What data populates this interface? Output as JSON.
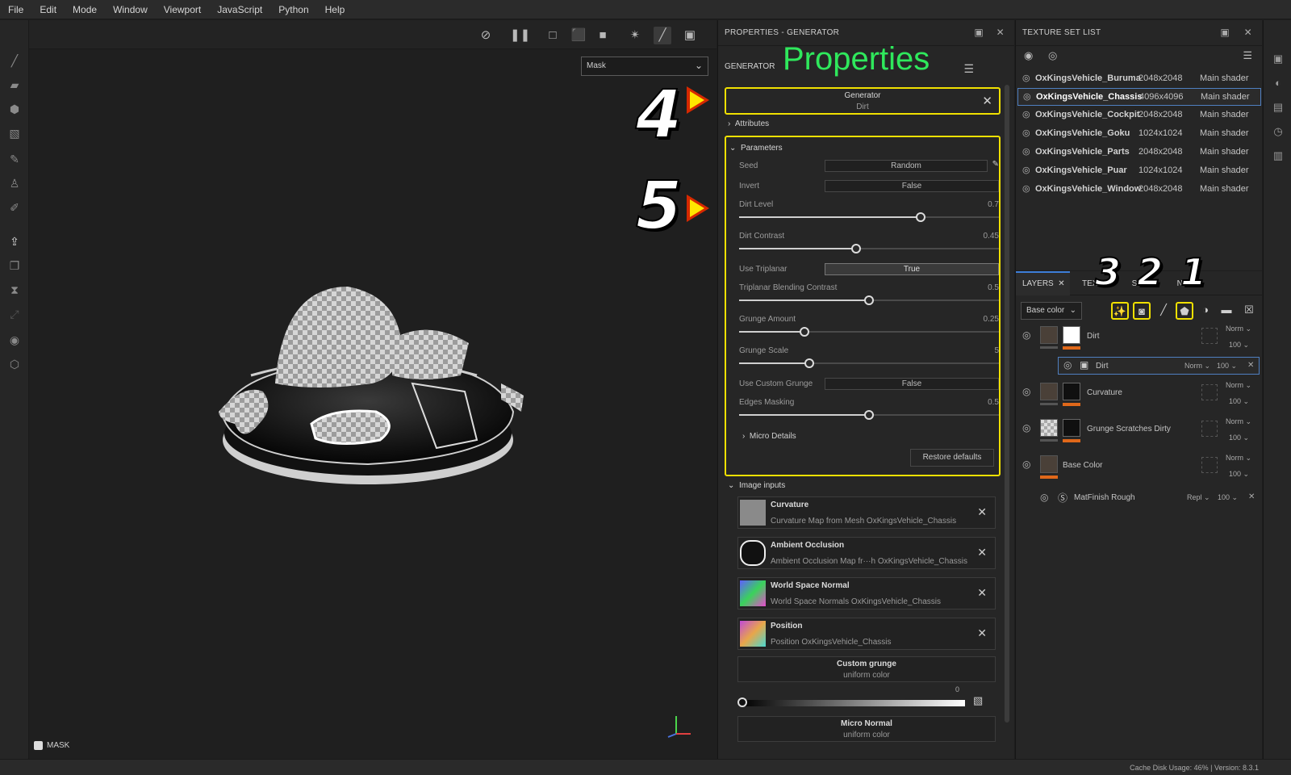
{
  "menu": [
    "File",
    "Edit",
    "Mode",
    "Window",
    "Viewport",
    "JavaScript",
    "Python",
    "Help"
  ],
  "viewport": {
    "channel_dropdown": "Mask",
    "mask_label": "MASK"
  },
  "annotations": {
    "n1": "1",
    "n2": "2",
    "n3": "3",
    "n4": "4",
    "n5": "5",
    "properties_word": "Properties"
  },
  "properties": {
    "title": "PROPERTIES - GENERATOR",
    "section": "GENERATOR",
    "generator_label": "Generator",
    "generator_value": "Dirt",
    "attributes": "Attributes",
    "parameters": "Parameters",
    "seed_label": "Seed",
    "seed_value": "Random",
    "invert_label": "Invert",
    "invert_value": "False",
    "dirt_level_label": "Dirt Level",
    "dirt_level_value": "0.7",
    "dirt_level": 0.7,
    "dirt_contrast_label": "Dirt Contrast",
    "dirt_contrast_value": "0.45",
    "dirt_contrast": 0.45,
    "use_triplanar_label": "Use Triplanar",
    "use_triplanar_value": "True",
    "triplanar_label": "Triplanar Blending Contrast",
    "triplanar_value": "0.5",
    "triplanar": 0.5,
    "grunge_amount_label": "Grunge Amount",
    "grunge_amount_value": "0.25",
    "grunge_amount": 0.25,
    "grunge_scale_label": "Grunge Scale",
    "grunge_scale_value": "5",
    "grunge_scale": 0.27,
    "use_custom_grunge_label": "Use Custom Grunge",
    "use_custom_grunge_value": "False",
    "edges_masking_label": "Edges Masking",
    "edges_masking_value": "0.5",
    "edges_masking": 0.5,
    "micro_details": "Micro Details",
    "restore_defaults": "Restore defaults",
    "image_inputs": "Image inputs",
    "inputs": [
      {
        "name": "Curvature",
        "desc": "Curvature Map from Mesh OxKingsVehicle_Chassis"
      },
      {
        "name": "Ambient Occlusion",
        "desc": "Ambient Occlusion Map fr···h OxKingsVehicle_Chassis"
      },
      {
        "name": "World Space Normal",
        "desc": "World Space Normals OxKingsVehicle_Chassis"
      },
      {
        "name": "Position",
        "desc": "Position OxKingsVehicle_Chassis"
      }
    ],
    "custom_grunge": "Custom grunge",
    "custom_grunge_sub": "uniform color",
    "grunge_slider_value": "0",
    "micro_normal": "Micro Normal",
    "micro_normal_sub": "uniform color"
  },
  "texture_set_list": {
    "title": "TEXTURE SET LIST",
    "rows": [
      {
        "name": "OxKingsVehicle_Buruma",
        "res": "2048x2048",
        "shader": "Main shader"
      },
      {
        "name": "OxKingsVehicle_Chassis",
        "res": "4096x4096",
        "shader": "Main shader"
      },
      {
        "name": "OxKingsVehicle_Cockpit",
        "res": "2048x2048",
        "shader": "Main shader"
      },
      {
        "name": "OxKingsVehicle_Goku",
        "res": "1024x1024",
        "shader": "Main shader"
      },
      {
        "name": "OxKingsVehicle_Parts",
        "res": "2048x2048",
        "shader": "Main shader"
      },
      {
        "name": "OxKingsVehicle_Puar",
        "res": "1024x1024",
        "shader": "Main shader"
      },
      {
        "name": "OxKingsVehicle_Window",
        "res": "2048x2048",
        "shader": "Main shader"
      }
    ]
  },
  "layers": {
    "tab_layers": "LAYERS",
    "tab_texset_a": "TEXTU",
    "tab_texset_b": "SET",
    "tab_texset_c": "NGS",
    "channel": "Base color",
    "rows": [
      {
        "name": "Dirt",
        "blend": "Norm",
        "opacity": "100"
      },
      {
        "name": "Dirt",
        "blend": "Norm",
        "opacity": "100"
      },
      {
        "name": "Curvature",
        "blend": "Norm",
        "opacity": "100"
      },
      {
        "name": "Grunge Scratches Dirty",
        "blend": "Norm",
        "opacity": "100"
      },
      {
        "name": "Base Color",
        "blend": "Norm",
        "opacity": "100"
      },
      {
        "name": "MatFinish Rough",
        "blend": "Repl",
        "opacity": "100"
      }
    ]
  },
  "status": "Cache Disk Usage:   46% | Version: 8.3.1"
}
